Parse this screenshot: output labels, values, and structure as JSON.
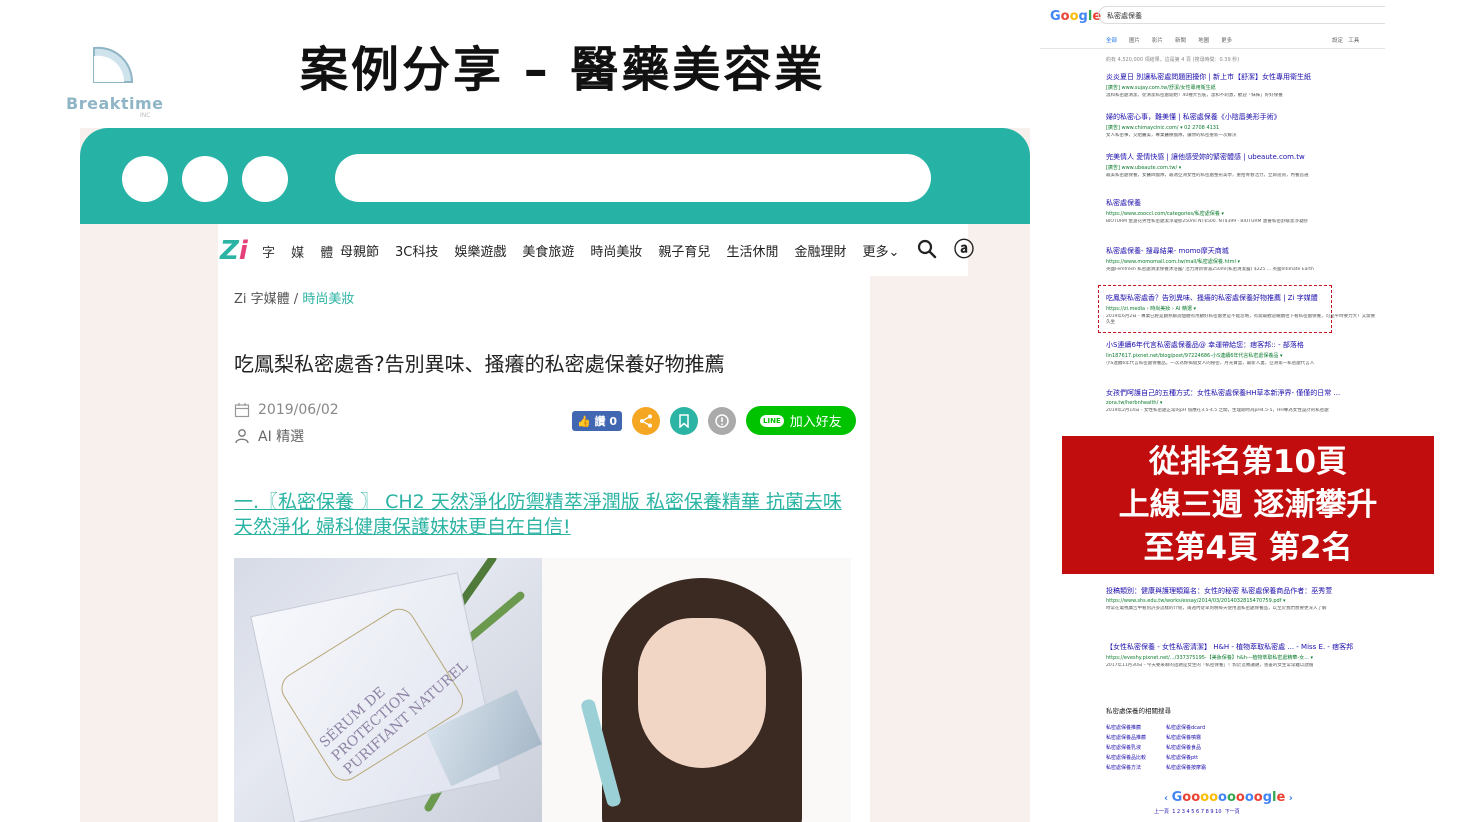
{
  "brand": {
    "name": "Breaktime",
    "sub": "INC"
  },
  "slide_title": "案例分享 – 醫藥美容業",
  "site": {
    "logo": {
      "z": "Z",
      "i": "i"
    },
    "name": "字 媒 體",
    "nav": [
      "母親節",
      "3C科技",
      "娛樂遊戲",
      "美食旅遊",
      "時尚美妝",
      "親子育兒",
      "生活休閒",
      "金融理財",
      "更多"
    ],
    "more_arrow": "⌄",
    "user_icon": "ⓐ"
  },
  "article": {
    "breadcrumb_site": "Zi 字媒體",
    "breadcrumb_sep": "/",
    "breadcrumb_category": "時尚美妝",
    "title": "吃鳳梨私密處香?告別異味、搔癢的私密處保養好物推薦",
    "date": "2019/06/02",
    "author": "AI 精選",
    "like_label": "讚 0",
    "line_label": "加入好友",
    "line_pill": "LINE",
    "subheading": "一.〖私密保養 〗 CH2 天然淨化防禦精萃淨潤版 私密保養精華 抗菌去味天然淨化 婦科健康保護妹妹更自在自信!",
    "product_text": "SÉRUM DE PROTECTION PURIFIANT NATUREL"
  },
  "google": {
    "logo": "Google",
    "query": "私密處保養",
    "tabs": [
      "全部",
      "圖片",
      "影片",
      "新聞",
      "地圖",
      "更多"
    ],
    "tools": [
      "設定",
      "工具"
    ],
    "stats": "約有 4,520,000 項結果，這是第 4 頁 (搜尋時間：0.39 秒)",
    "results": [
      {
        "title": "炎炎夏日 別讓私密處問題困擾你 | 新上市【舒潔】女性專用衛生紙",
        "url": "[廣告] www.sujay.com.tw/舒潔/女性專用衛生紙",
        "desc": "溫和私密處清潔，從清潔私密處開始！40種大包裝，溫和不刺激，歡迎「妹妹」好好保養"
      },
      {
        "title": "婦的私密心事，難美懂 | 私密處保養《小陰唇美形手術》",
        "url": "[廣告] www.chimaycinic.com/ ▾ 02 2708 4131",
        "desc": "女人私密事，交給醫美，專業醫療團隊，讓你的私密重新一次解決"
      },
      {
        "title": "完美情人 愛情快感 | 讓他感受妳的緊密體感 | ubeaute.com.tw",
        "url": "[廣告] www.ubeaute.com.tw/ ▾",
        "desc": "最美私密處保養，女醫師團隊，最適亞洲女性的私密處整形美學，重拾青春活力，立即諮詢，內養首選"
      },
      {
        "title": "私密處保養",
        "url": "https://www.zooccl.com/categories/私密處保養 ▾",
        "desc": "BIOTURM 金盞花男性私密處潔淨凝膠250ml NT$500. NT$399 · BIOTURM 蘆薈私密舒緩潔淨凝膠"
      },
      {
        "title": "私密處保養- 搜尋結果- momo摩天商城",
        "url": "https://www.momomall.com.tw/mall/私密處保養.html ▾",
        "desc": "英國Femfresh 私密處清潔保養沐浴露/ 活力清新保濕250ml(私密清潔露) $225 ... 英國Intimate Earth"
      },
      {
        "title": "吃鳳梨私密處香？告別異味、搔癢的私密處保養好物推薦 | Zi 字媒體",
        "url": "https://zi.media › 時尚美妝 › AI 精選 ▾",
        "desc": "2019年6月2日 - 專業已經是翻熟解說個體有用顧好私密處更是不能忽略，有需最歡迎繼續往下看私密處保養，可是平時要力大！又需要久坐"
      },
      {
        "title": "小S連續6年代言私密處保養品@ 幸運帶給您：痞客邦:: - 部落格",
        "url": "lin187617.pixnet.net/blog/post/97224686-小S連續6年代言私密處保養品 ▾",
        "desc": "小S連續6年代言私密處保養品，一次為妳揭開女人的秘密，月光寶盒，最新人妻，亞洲第一私密處代言人"
      },
      {
        "title": "女孩們呵護自己的五種方式：女性私密處保養HH草本新淨界- 僅僅的日常 ...",
        "url": "zora.tw/herbnhealth/ ▾",
        "desc": "2019年2月14日 - 女性私密處正常的pH 值應在3.5-4.5 之間，生理期時為pH4.5-5，HH專為女性設計的私密處"
      },
      {
        "title": "投稿類別：健康與護理類篇名：女性的秘密 私密處保養商品作者：巫秀萱",
        "url": "https://www.shs.edu.tw/works/essay/2014/03/2014032815470759.pdf ▾",
        "desc": "時常在電視廣告中看到許多這樣的介紹，兩週內從早到晚每天使用過私密處保養品，以至於我們想要更深入了解"
      },
      {
        "title": "【女性私密保養 - 女性私密清潔】 H&H - 植物萃取私密處 ... - Miss E. - 痞客邦",
        "url": "https://eveshy.pixnet.net/.../337375195-【美妝保養】h&h---植物萃取私密處精華-女... ▾",
        "desc": "2017年11月30日 - 今天要來聊的話題是女生的「私密保養」！對於這類議題，害羞的女生常常難以啟齒"
      }
    ],
    "related_title": "私密處保養的相關搜尋",
    "related": [
      "私密處保養推薦",
      "私密處保養dcard",
      "私密處保養品推薦",
      "私密處保養噴霧",
      "私密處保養乳液",
      "私密處保養食品",
      "私密處保養品比較",
      "私密處保養ptt",
      "私密處保養方法",
      "私密處保養按摩霜"
    ],
    "pager": {
      "prev": "上一頁",
      "next": "下一頁",
      "nums": "1 2 3 4 5 6 7 8 9 10"
    }
  },
  "callout": [
    "從排名第10頁",
    "上線三週 逐漸攀升",
    "至第4頁 第2名"
  ],
  "colors": {
    "teal": "#26b3a5",
    "red": "#c10d0d",
    "pink": "#e5407a"
  }
}
